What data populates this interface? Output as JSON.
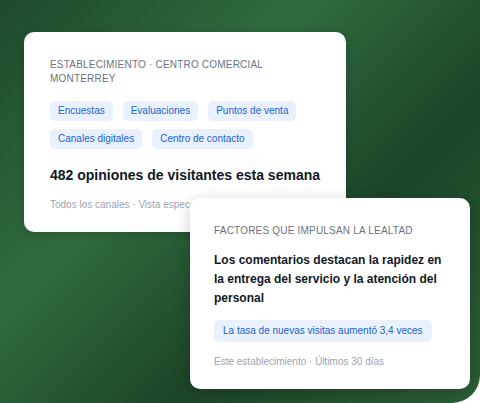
{
  "card1": {
    "header": "ESTABLECIMIENTO · CENTRO COMERCIAL MONTERREY",
    "tags": [
      "Encuestas",
      "Evaluaciones",
      "Puntos de venta",
      "Canales digitales",
      "Centro de contacto"
    ],
    "heading": "482 opiniones de visitantes esta semana",
    "footer": "Todos los canales · Vista espec"
  },
  "card2": {
    "header": "FACTORES QUE IMPULSAN LA LEALTAD",
    "text": "Los comentarios destacan la rapidez en la entrega del servicio y la atención del personal",
    "badge": "La tasa de nuevas visitas aumentó 3,4 veces",
    "footer": "Este establecimiento · Últimos 30 días"
  }
}
